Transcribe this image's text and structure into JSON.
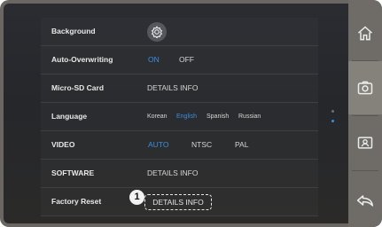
{
  "settings": {
    "rows": [
      {
        "label": "Background",
        "icon": "gear-icon"
      },
      {
        "label": "Auto-Overwriting",
        "options": [
          "ON",
          "OFF"
        ],
        "selected": "ON"
      },
      {
        "label": "Micro-SD Card",
        "value": "DETAILS INFO"
      },
      {
        "label": "Language",
        "options": [
          "Korean",
          "English",
          "Spanish",
          "Russian"
        ],
        "selected": "English"
      },
      {
        "label": "VIDEO",
        "options": [
          "AUTO",
          "NTSC",
          "PAL"
        ],
        "selected": "AUTO"
      },
      {
        "label": "SOFTWARE",
        "value": "DETAILS INFO"
      },
      {
        "label": "Factory Reset",
        "value": "DETAILS INFO"
      }
    ]
  },
  "callout": {
    "number": "1"
  },
  "sidebar": {
    "items": [
      {
        "icon": "home-icon"
      },
      {
        "icon": "camera-settings-icon",
        "active": true
      },
      {
        "icon": "contact-card-icon"
      },
      {
        "icon": "back-arrow-icon"
      }
    ]
  },
  "page_indicator": {
    "count": 2,
    "current": 2
  },
  "colors": {
    "accent": "#3a8fe0",
    "text": "#e8e8e8",
    "panel": "#26282c",
    "sidebar": "#6f6c67"
  }
}
